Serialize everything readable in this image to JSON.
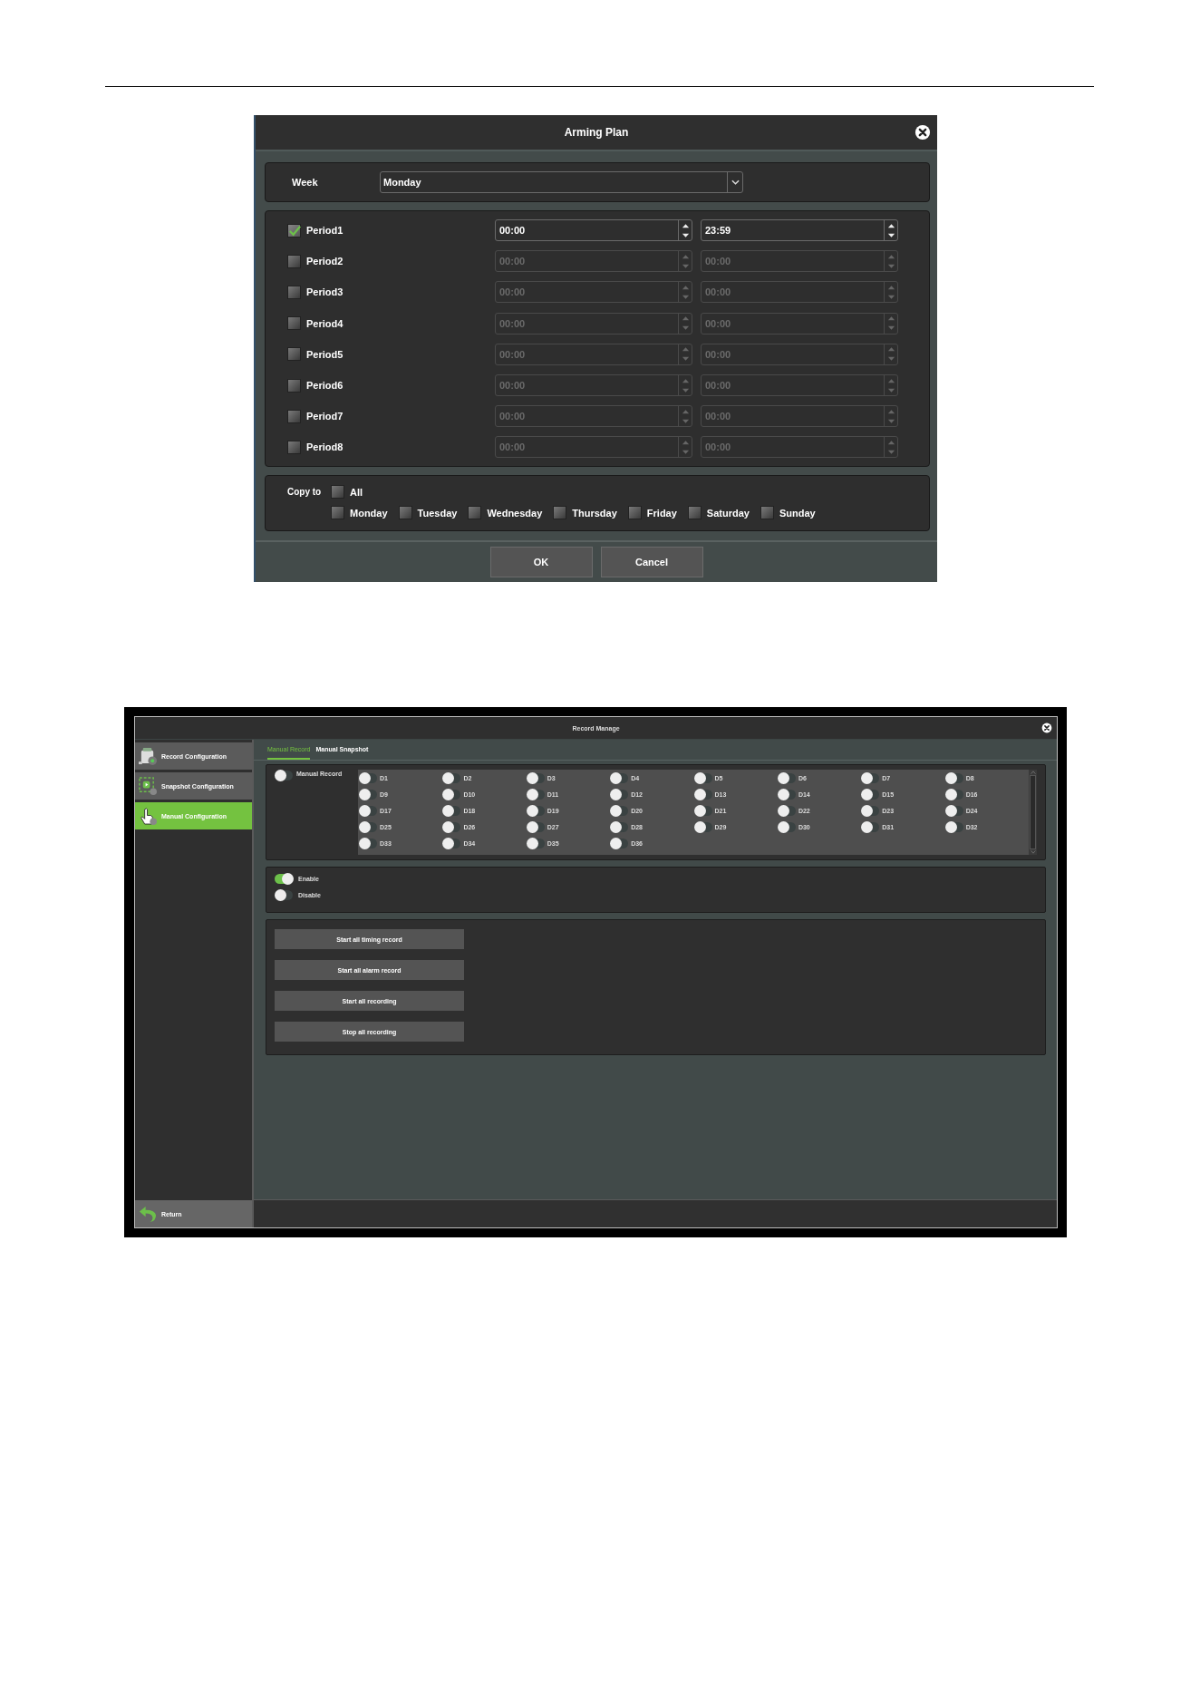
{
  "arming_plan": {
    "title": "Arming Plan",
    "week": {
      "label": "Week",
      "value": "Monday"
    },
    "periods": [
      {
        "label": "Period1",
        "checked": true,
        "start": "00:00",
        "end": "23:59"
      },
      {
        "label": "Period2",
        "checked": false,
        "start": "00:00",
        "end": "00:00"
      },
      {
        "label": "Period3",
        "checked": false,
        "start": "00:00",
        "end": "00:00"
      },
      {
        "label": "Period4",
        "checked": false,
        "start": "00:00",
        "end": "00:00"
      },
      {
        "label": "Period5",
        "checked": false,
        "start": "00:00",
        "end": "00:00"
      },
      {
        "label": "Period6",
        "checked": false,
        "start": "00:00",
        "end": "00:00"
      },
      {
        "label": "Period7",
        "checked": false,
        "start": "00:00",
        "end": "00:00"
      },
      {
        "label": "Period8",
        "checked": false,
        "start": "00:00",
        "end": "00:00"
      }
    ],
    "copy_to": {
      "label": "Copy to",
      "all": {
        "label": "All",
        "checked": false
      },
      "days": [
        {
          "label": "Monday",
          "checked": false
        },
        {
          "label": "Tuesday",
          "checked": false
        },
        {
          "label": "Wednesday",
          "checked": false
        },
        {
          "label": "Thursday",
          "checked": false
        },
        {
          "label": "Friday",
          "checked": false
        },
        {
          "label": "Saturday",
          "checked": false
        },
        {
          "label": "Sunday",
          "checked": false
        }
      ]
    },
    "buttons": [
      "OK",
      "Cancel"
    ]
  },
  "record_manage": {
    "title": "Record Manage",
    "sidebar": {
      "items": [
        {
          "label": "Record Configuration",
          "selected": false
        },
        {
          "label": "Snapshot Configuration",
          "selected": false
        },
        {
          "label": "Manual Configuration",
          "selected": true
        }
      ],
      "return": "Return"
    },
    "tabs": [
      {
        "label": "Manual Record",
        "selected": true
      },
      {
        "label": "Manual Snapshot",
        "selected": false
      }
    ],
    "manual_record": {
      "label": "Manual Record",
      "on": false
    },
    "channels": [
      {
        "label": "D1",
        "on": false
      },
      {
        "label": "D2",
        "on": false
      },
      {
        "label": "D3",
        "on": false
      },
      {
        "label": "D4",
        "on": false
      },
      {
        "label": "D5",
        "on": false
      },
      {
        "label": "D6",
        "on": false
      },
      {
        "label": "D7",
        "on": false
      },
      {
        "label": "D8",
        "on": false
      },
      {
        "label": "D9",
        "on": false
      },
      {
        "label": "D10",
        "on": false
      },
      {
        "label": "D11",
        "on": false
      },
      {
        "label": "D12",
        "on": false
      },
      {
        "label": "D13",
        "on": false
      },
      {
        "label": "D14",
        "on": false
      },
      {
        "label": "D15",
        "on": false
      },
      {
        "label": "D16",
        "on": false
      },
      {
        "label": "D17",
        "on": false
      },
      {
        "label": "D18",
        "on": false
      },
      {
        "label": "D19",
        "on": false
      },
      {
        "label": "D20",
        "on": false
      },
      {
        "label": "D21",
        "on": false
      },
      {
        "label": "D22",
        "on": false
      },
      {
        "label": "D23",
        "on": false
      },
      {
        "label": "D24",
        "on": false
      },
      {
        "label": "D25",
        "on": false
      },
      {
        "label": "D26",
        "on": false
      },
      {
        "label": "D27",
        "on": false
      },
      {
        "label": "D28",
        "on": false
      },
      {
        "label": "D29",
        "on": false
      },
      {
        "label": "D30",
        "on": false
      },
      {
        "label": "D31",
        "on": false
      },
      {
        "label": "D32",
        "on": false
      },
      {
        "label": "D33",
        "on": false
      },
      {
        "label": "D34",
        "on": false
      },
      {
        "label": "D35",
        "on": false
      },
      {
        "label": "D36",
        "on": false
      }
    ],
    "modes": [
      {
        "label": "Enable",
        "on": true
      },
      {
        "label": "Disable",
        "on": false
      }
    ],
    "actions": [
      "Start all timing record",
      "Start all alarm record",
      "Start all recording",
      "Stop all recording"
    ]
  }
}
